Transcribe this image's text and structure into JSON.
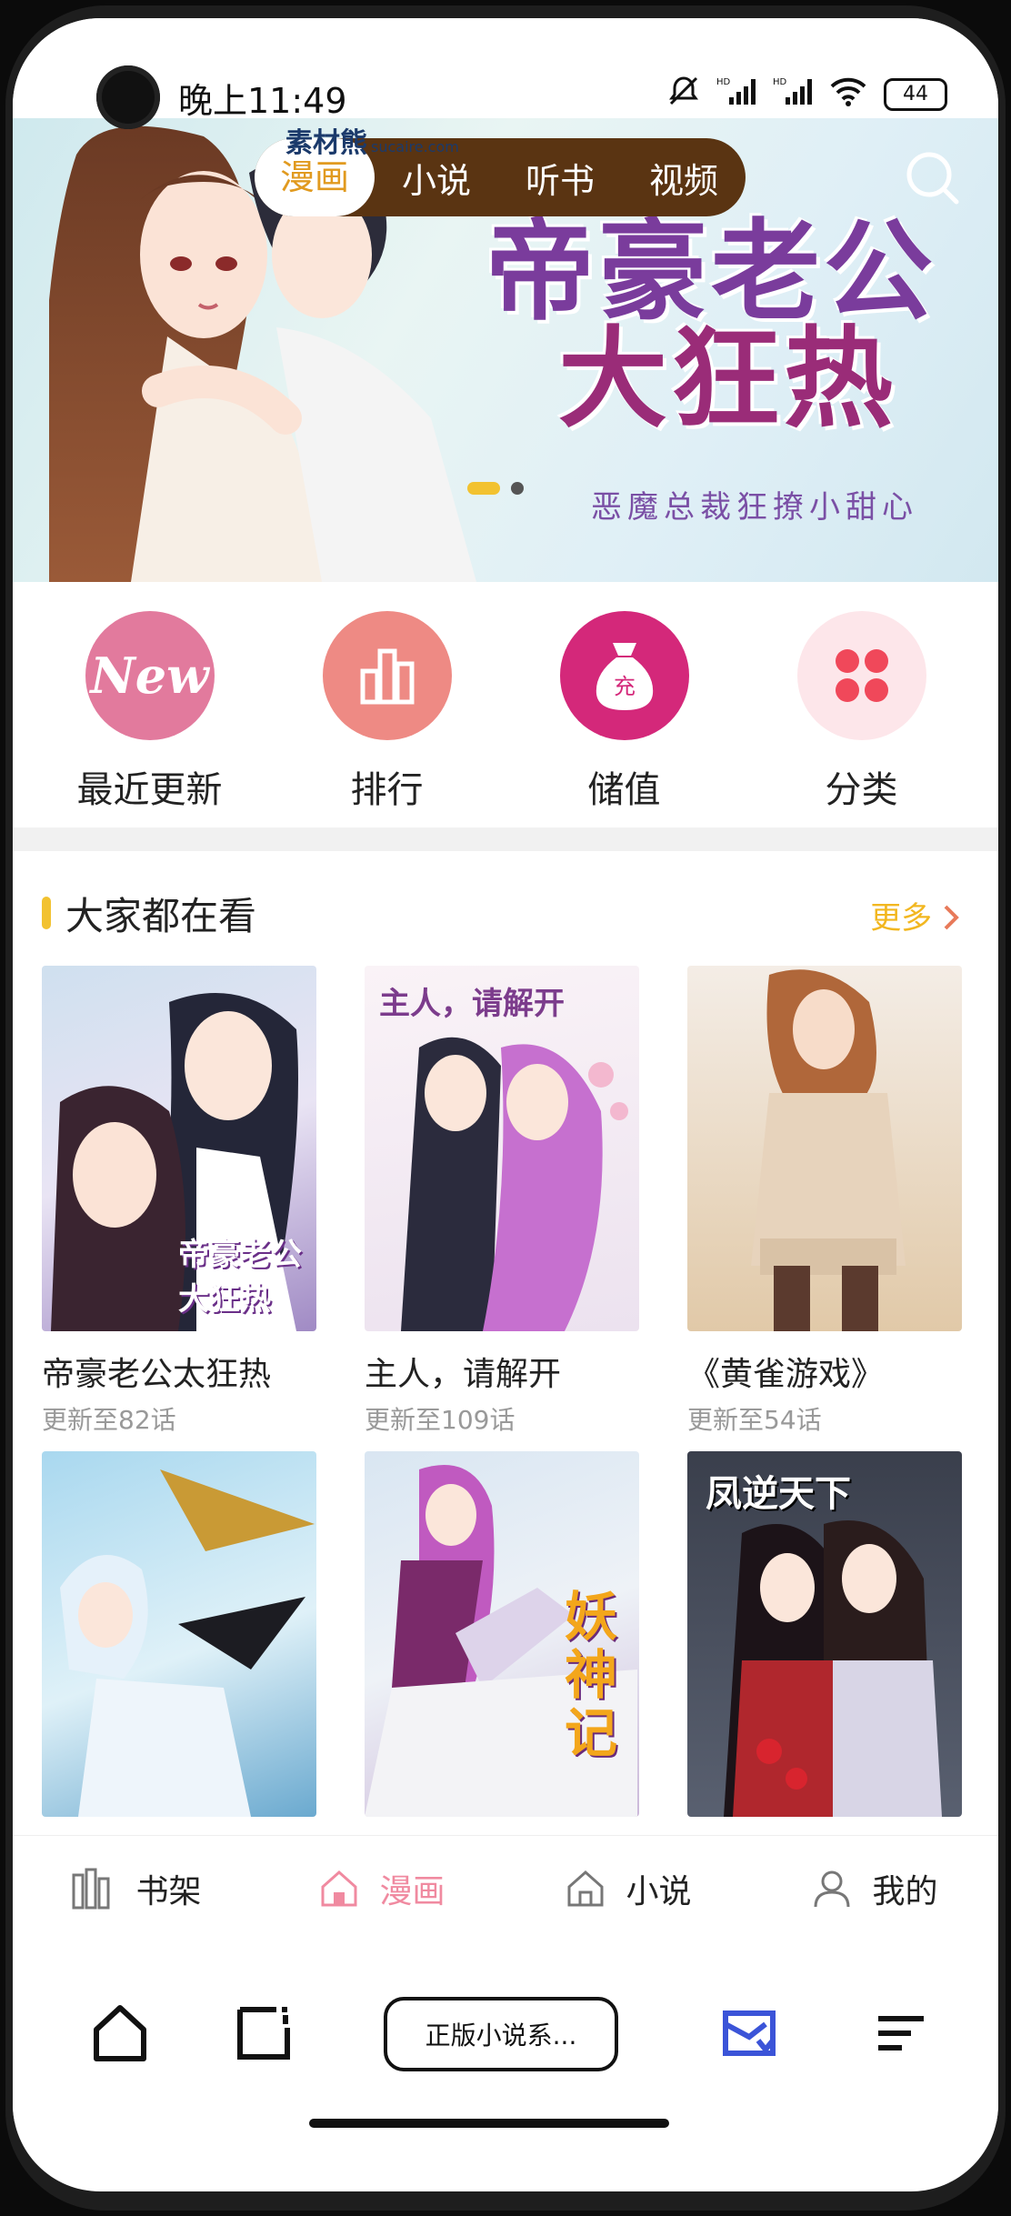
{
  "status_bar": {
    "time": "晚上11:49",
    "signal1": "HD",
    "signal2": "HD",
    "battery": "44"
  },
  "top_tabs": [
    {
      "label": "漫画",
      "active": true
    },
    {
      "label": "小说",
      "active": false
    },
    {
      "label": "听书",
      "active": false
    },
    {
      "label": "视频",
      "active": false
    }
  ],
  "watermark": {
    "brand": "素材熊",
    "domain": "sucaire.com"
  },
  "banner": {
    "title_line1": "帝豪老公",
    "title_line2": "大狂热",
    "subtitle": "恶魔总裁狂撩小甜心",
    "page_count": 2,
    "current_page": 1
  },
  "quick_nav": [
    {
      "label": "最近更新",
      "icon": "new-badge-icon",
      "icon_text": "New",
      "color": "#e27a9d"
    },
    {
      "label": "排行",
      "icon": "bar-chart-icon",
      "color": "#ee8a84"
    },
    {
      "label": "储值",
      "icon": "money-bag-icon",
      "icon_text": "充",
      "color": "#d4287a"
    },
    {
      "label": "分类",
      "icon": "grid-four-icon",
      "color": "#fde6ea"
    }
  ],
  "section": {
    "title": "大家都在看",
    "more_label": "更多"
  },
  "comics": [
    {
      "title": "帝豪老公太狂热",
      "update": "更新至82话",
      "cover_text": "帝豪老公大狂热",
      "cover_colors": [
        "#cfe0ef",
        "#6b4a6e"
      ]
    },
    {
      "title": "主人，请解开",
      "update": "更新至109话",
      "cover_text": "主人，请解开",
      "cover_colors": [
        "#f6eef4",
        "#b76fc4"
      ]
    },
    {
      "title": "《黄雀游戏》",
      "update": "更新至54话",
      "cover_text": "",
      "cover_colors": [
        "#f5ece4",
        "#c7a27b"
      ]
    },
    {
      "title": "",
      "update": "",
      "cover_text": "",
      "cover_colors": [
        "#a9d8ef",
        "#3c6a9c"
      ]
    },
    {
      "title": "",
      "update": "",
      "cover_text": "妖神记",
      "cover_colors": [
        "#d9e6f2",
        "#8a4a9a"
      ]
    },
    {
      "title": "",
      "update": "",
      "cover_text": "凤逆天下",
      "cover_colors": [
        "#3a3f4c",
        "#b0272d"
      ]
    }
  ],
  "tab_bar": [
    {
      "label": "书架",
      "icon": "bookshelf-icon",
      "active": false
    },
    {
      "label": "漫画",
      "icon": "home-icon",
      "active": true
    },
    {
      "label": "小说",
      "icon": "house-icon",
      "active": false
    },
    {
      "label": "我的",
      "icon": "user-icon",
      "active": false
    }
  ],
  "browser": {
    "url_label": "正版小说系..."
  },
  "colors": {
    "accent": "#f2c230",
    "active_tab": "#f08aa0",
    "tabs_bg": "#5a3412"
  }
}
